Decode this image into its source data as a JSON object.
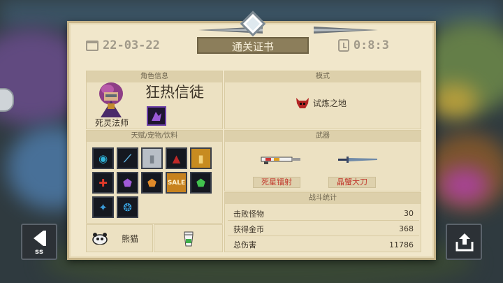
{
  "header": {
    "date": "22-03-22",
    "title": "通关证书",
    "duration": "0:8:3"
  },
  "character": {
    "section_label": "角色信息",
    "class": "死灵法师",
    "name": "狂热信徒"
  },
  "mode": {
    "section_label": "模式",
    "value": "试炼之地"
  },
  "talents": {
    "section_label": "天赋/宠物/饮料",
    "sale_label": "SALE"
  },
  "weapons": {
    "section_label": "武器",
    "items": [
      "死星镭射",
      "晶蟹大刀"
    ]
  },
  "stats": {
    "section_label": "战斗统计",
    "rows": [
      {
        "label": "击败怪物",
        "value": "30"
      },
      {
        "label": "获得金币",
        "value": "368"
      },
      {
        "label": "总伤害",
        "value": "11786"
      }
    ]
  },
  "pet": {
    "name": "熊猫"
  },
  "controls": {
    "back_label": "ss"
  },
  "colors": {
    "panel": "#f1e7cb",
    "banner": "#8c7e5b",
    "weapon_tag_text": "#c23b2f"
  }
}
